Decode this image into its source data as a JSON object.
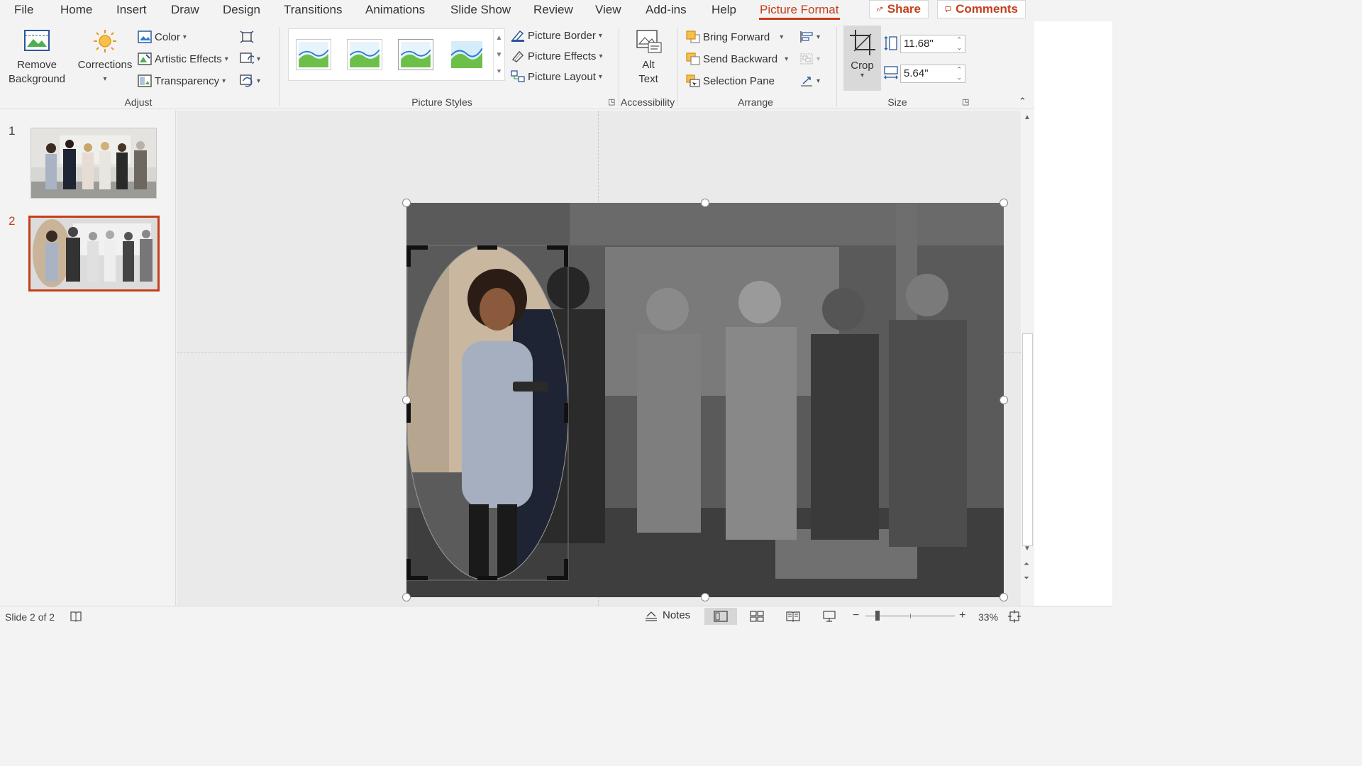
{
  "menu": {
    "tabs": [
      "File",
      "Home",
      "Insert",
      "Draw",
      "Design",
      "Transitions",
      "Animations",
      "Slide Show",
      "Review",
      "View",
      "Add-ins",
      "Help",
      "Picture Format"
    ],
    "active": "Picture Format",
    "share_label": "Share",
    "comments_label": "Comments"
  },
  "ribbon": {
    "adjust": {
      "label": "Adjust",
      "remove_background": [
        "Remove",
        "Background"
      ],
      "corrections": "Corrections",
      "color": "Color",
      "artistic_effects": "Artistic Effects",
      "transparency": "Transparency"
    },
    "picture_styles": {
      "label": "Picture Styles",
      "picture_border": "Picture Border",
      "picture_effects": "Picture Effects",
      "picture_layout": "Picture Layout"
    },
    "accessibility": {
      "label": "Accessibility",
      "alt_text": [
        "Alt",
        "Text"
      ]
    },
    "arrange": {
      "label": "Arrange",
      "bring_forward": "Bring Forward",
      "send_backward": "Send Backward",
      "selection_pane": "Selection Pane"
    },
    "size": {
      "label": "Size",
      "crop": "Crop",
      "height": "11.68\"",
      "width": "5.64\""
    }
  },
  "slides": [
    {
      "number": "1",
      "selected": false
    },
    {
      "number": "2",
      "selected": true
    }
  ],
  "status": {
    "slide_info": "Slide 2 of 2",
    "notes": "Notes",
    "zoom": "33%",
    "zoom_minus": "−",
    "zoom_plus": "+"
  },
  "colors": {
    "accent": "#c43e1c",
    "ribbon_bg": "#f3f3f3"
  }
}
